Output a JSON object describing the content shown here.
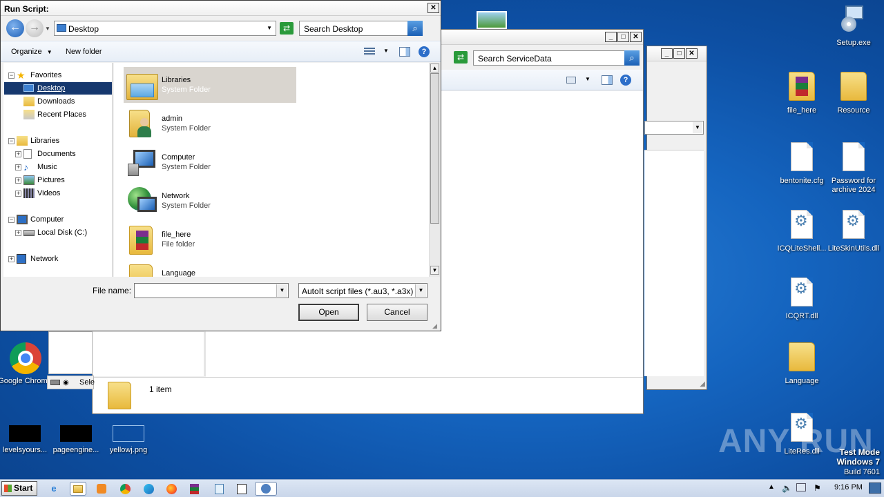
{
  "dialog": {
    "title": "Run Script:",
    "address": "Desktop",
    "search_placeholder": "Search Desktop",
    "organize": "Organize",
    "new_folder": "New folder",
    "nav_tree": [
      {
        "label": "Favorites",
        "icon": "star-icon",
        "indent": 0,
        "expander": "−"
      },
      {
        "label": "Desktop",
        "icon": "desktop-icon",
        "indent": 1,
        "selected": true
      },
      {
        "label": "Downloads",
        "icon": "downloads-icon",
        "indent": 1
      },
      {
        "label": "Recent Places",
        "icon": "recent-places-icon",
        "indent": 1
      },
      {
        "label": "Libraries",
        "icon": "libraries-icon",
        "indent": 0,
        "expander": "−"
      },
      {
        "label": "Documents",
        "icon": "documents-icon",
        "indent": 1,
        "expander": "+"
      },
      {
        "label": "Music",
        "icon": "music-icon",
        "indent": 1,
        "expander": "+"
      },
      {
        "label": "Pictures",
        "icon": "pictures-icon",
        "indent": 1,
        "expander": "+"
      },
      {
        "label": "Videos",
        "icon": "videos-icon",
        "indent": 1,
        "expander": "+"
      },
      {
        "label": "Computer",
        "icon": "computer-icon",
        "indent": 0,
        "expander": "−"
      },
      {
        "label": "Local Disk (C:)",
        "icon": "drive-icon",
        "indent": 1,
        "expander": "+"
      },
      {
        "label": "Network",
        "icon": "network-icon",
        "indent": 0,
        "expander": "+"
      }
    ],
    "files": [
      {
        "name": "Libraries",
        "type": "System Folder",
        "icon": "libraries-folder-icon",
        "highlighted": true
      },
      {
        "name": "admin",
        "type": "System Folder",
        "icon": "user-folder-icon"
      },
      {
        "name": "Computer",
        "type": "System Folder",
        "icon": "computer-icon"
      },
      {
        "name": "Network",
        "type": "System Folder",
        "icon": "network-globe-icon"
      },
      {
        "name": "file_here",
        "type": "File folder",
        "icon": "archive-folder-icon"
      },
      {
        "name": "Language",
        "type": "",
        "icon": "folder-icon"
      }
    ],
    "file_name_label": "File name:",
    "file_name_value": "",
    "file_type": "AutoIt script files (*.au3, *.a3x)",
    "open_label": "Open",
    "cancel_label": "Cancel"
  },
  "explorer": {
    "search_placeholder": "Search ServiceData",
    "item_count": "1 item",
    "status_fragment": "Sele"
  },
  "desktop_icons": [
    {
      "label": "Setup.exe",
      "kind": "installer"
    },
    {
      "label": "file_here",
      "kind": "rar-folder"
    },
    {
      "label": "Resource",
      "kind": "folder"
    },
    {
      "label": "bentonite.cfg",
      "kind": "doc"
    },
    {
      "label": "Password for archive 2024",
      "kind": "doc"
    },
    {
      "label": "ICQLiteShell...",
      "kind": "dll"
    },
    {
      "label": "LiteSkinUtils.dll",
      "kind": "dll"
    },
    {
      "label": "ICQRT.dll",
      "kind": "dll"
    },
    {
      "label": "Language",
      "kind": "folder"
    },
    {
      "label": "LiteRes.dll",
      "kind": "dll"
    },
    {
      "label": "Google Chrome",
      "kind": "chrome"
    },
    {
      "label": "levelsyours...",
      "kind": "black"
    },
    {
      "label": "pageengine...",
      "kind": "black"
    },
    {
      "label": "yellowj.png",
      "kind": "image"
    }
  ],
  "taskbar": {
    "start": "Start",
    "clock": "9:16 PM"
  },
  "watermark": {
    "brand": "ANY RUN",
    "test_mode": "Test Mode",
    "os": "Windows 7",
    "build": "Build 7601"
  }
}
